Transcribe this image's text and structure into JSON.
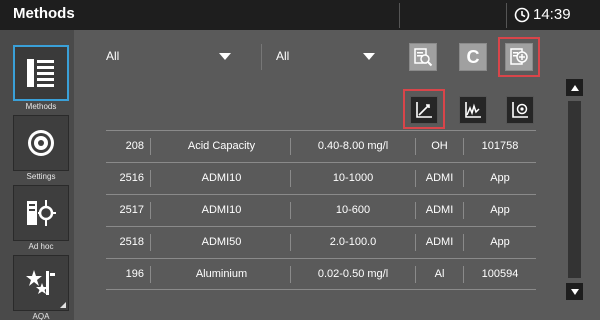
{
  "header": {
    "title": "Methods",
    "time": "14:39"
  },
  "nav": {
    "items": [
      {
        "label": "Methods",
        "icon": "methods-list-icon",
        "active": true
      },
      {
        "label": "Settings",
        "icon": "settings-gear-icon",
        "active": false
      },
      {
        "label": "Ad hoc",
        "icon": "ad-hoc-icon",
        "active": false
      },
      {
        "label": "AQA",
        "icon": "aqa-stars-icon",
        "active": false
      }
    ]
  },
  "filters": {
    "filter1": "All",
    "filter2": "All"
  },
  "toolbar": {
    "c_label": "C"
  },
  "table": {
    "rows": [
      {
        "no": "208",
        "name": "Acid Capacity",
        "range": "0.40-8.00 mg/l",
        "form": "OH",
        "code": "101758"
      },
      {
        "no": "2516",
        "name": "ADMI10",
        "range": "10-1000",
        "form": "ADMI",
        "code": "App"
      },
      {
        "no": "2517",
        "name": "ADMI10",
        "range": "10-600",
        "form": "ADMI",
        "code": "App"
      },
      {
        "no": "2518",
        "name": "ADMI50",
        "range": "2.0-100.0",
        "form": "ADMI",
        "code": "App"
      },
      {
        "no": "196",
        "name": "Aluminium",
        "range": "0.02-0.50 mg/l",
        "form": "Al",
        "code": "100594"
      }
    ]
  },
  "colors": {
    "highlight": "#d9454a",
    "active_nav_border": "#3aa0d8",
    "background": "#5a5a5a",
    "titlebar": "#1e1e1e"
  }
}
